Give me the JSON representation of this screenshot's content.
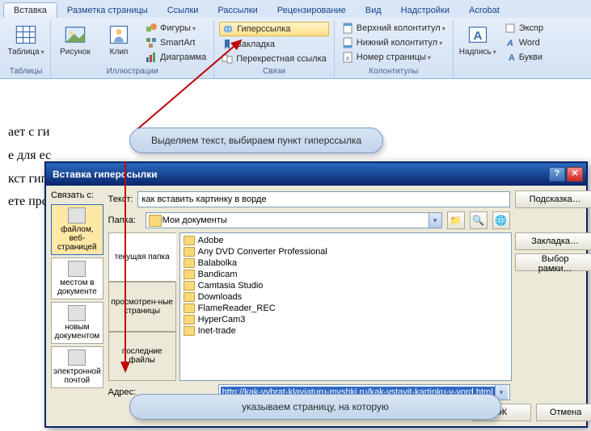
{
  "ribbon": {
    "tabs": [
      "Вставка",
      "Разметка страницы",
      "Ссылки",
      "Рассылки",
      "Рецензирование",
      "Вид",
      "Надстройки",
      "Acrobat"
    ],
    "active_tab": 0,
    "groups": {
      "tables": {
        "label": "Таблицы",
        "table_btn": "Таблица"
      },
      "illustrations": {
        "label": "Иллюстрации",
        "picture": "Рисунок",
        "clip": "Клип",
        "shapes": "Фигуры",
        "smartart": "SmartArt",
        "chart": "Диаграмма"
      },
      "links": {
        "label": "Связи",
        "hyperlink": "Гиперссылка",
        "bookmark": "Закладка",
        "crossref": "Перекрестная ссылка"
      },
      "headerfooter": {
        "label": "Колонтитулы",
        "header": "Верхний колонтитул",
        "footer": "Нижний колонтитул",
        "pagenum": "Номер страницы"
      },
      "text": {
        "label": "",
        "textbox": "Надпись",
        "express": "Экспр",
        "wordart": "Word",
        "dropcap": "Букви"
      }
    }
  },
  "doc_lines": [
    "ает с ги",
    "е для ес",
    "кст гип",
    "ете про"
  ],
  "callouts": {
    "top": "Выделяем текст, выбираем пункт гиперссылка",
    "bottom": "указываем страницу, на которую"
  },
  "dialog": {
    "title": "Вставка гиперссылки",
    "link_to_label": "Связать с:",
    "link_options": [
      "файлом, веб-страницей",
      "местом в документе",
      "новым документом",
      "электронной почтой"
    ],
    "text_label": "Текст:",
    "text_value": "как вставить картинку в ворде",
    "tooltip_btn": "Подсказка…",
    "folder_label": "Папка:",
    "folder_value": "Мои документы",
    "sub_tabs": [
      "текущая папка",
      "просмотрен-ные страницы",
      "последние файлы"
    ],
    "files": [
      "Adobe",
      "Any DVD Converter Professional",
      "Balabolka",
      "Bandicam",
      "Camtasia Studio",
      "Downloads",
      "FlameReader_REC",
      "HyperCam3",
      "Inet-trade"
    ],
    "bookmark_btn": "Закладка…",
    "frame_btn": "Выбор рамки…",
    "address_label": "Адрес:",
    "address_value": "http://kak-vybrat-klaviaturu-myshki.ru/kak-vstavit-kartinku-v-vord.html",
    "ok": "ОК",
    "cancel": "Отмена"
  }
}
